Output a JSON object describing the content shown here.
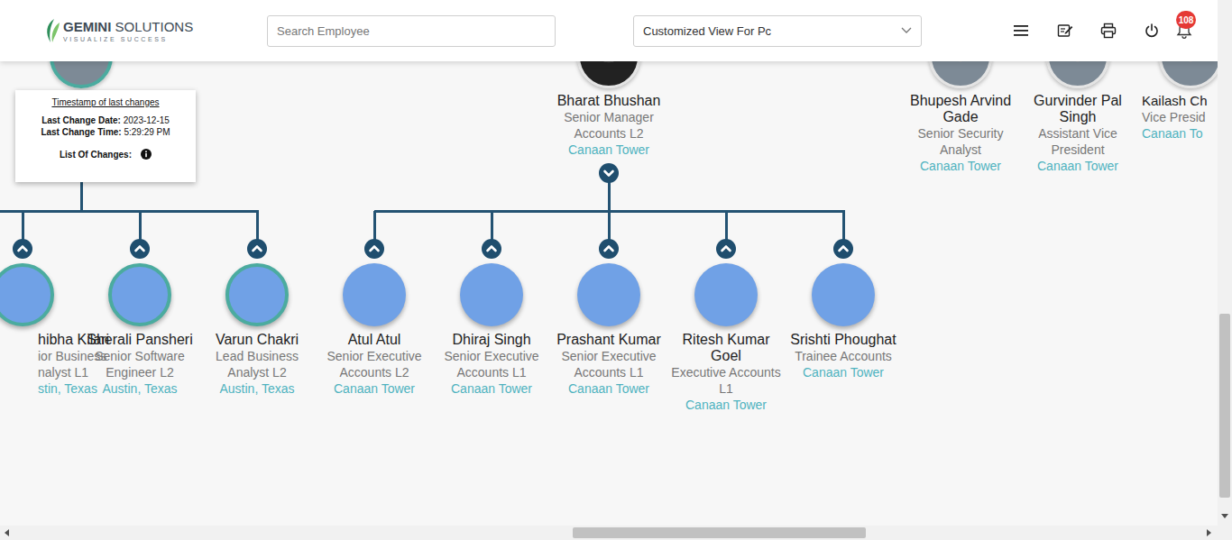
{
  "header": {
    "logo": {
      "brand": "GEMINI",
      "suffix": "SOLUTIONS",
      "tagline": "VISUALIZE SUCCESS"
    },
    "search": {
      "placeholder": "Search Employee"
    },
    "view_select": {
      "value": "Customized View For Pc"
    },
    "notifications": {
      "count": "108"
    }
  },
  "tooltip_node": {
    "ring": true,
    "tooltip": {
      "title": "Timestamp of last changes",
      "rows": [
        {
          "label": "Last Change Date:",
          "value": "2023-12-15"
        },
        {
          "label": "Last Change Time:",
          "value": "5:29:29 PM"
        }
      ],
      "changes_label": "List Of Changes:"
    }
  },
  "managers": [
    {
      "name": "Bharat Bhushan",
      "title": "Senior Manager Accounts L2",
      "location": "Canaan Tower",
      "ring": false,
      "has_reports": true,
      "expanded": true
    },
    {
      "name": "Bhupesh Arvind Gade",
      "title": "Senior Security Analyst",
      "location": "Canaan Tower",
      "ring": false,
      "has_reports": false,
      "expanded": false
    },
    {
      "name": "Gurvinder Pal Singh",
      "title": "Assistant Vice President",
      "location": "Canaan Tower",
      "ring": false,
      "has_reports": false,
      "expanded": false
    },
    {
      "name": "Kailash Ch",
      "title": "Vice Presid",
      "location": "Canaan To",
      "ring": false,
      "has_reports": false,
      "expanded": false
    }
  ],
  "teams": [
    {
      "ring": true,
      "members": [
        {
          "name": "hibha Kilari",
          "title": "ior Business nalyst L1",
          "location": "stin, Texas"
        },
        {
          "name": "Sherali Pansheri",
          "title": "Senior Software Engineer L2",
          "location": "Austin, Texas"
        },
        {
          "name": "Varun Chakri",
          "title": "Lead Business Analyst L2",
          "location": "Austin, Texas"
        }
      ]
    },
    {
      "ring": false,
      "members": [
        {
          "name": "Atul Atul",
          "title": "Senior Executive Accounts L2",
          "location": "Canaan Tower"
        },
        {
          "name": "Dhiraj Singh",
          "title": "Senior Executive Accounts L1",
          "location": "Canaan Tower"
        },
        {
          "name": "Prashant Kumar",
          "title": "Senior Executive Accounts L1",
          "location": "Canaan Tower"
        },
        {
          "name": "Ritesh Kumar Goel",
          "title": "Executive Accounts L1",
          "location": "Canaan Tower"
        },
        {
          "name": "Srishti Phoughat",
          "title": "Trainee Accounts",
          "location": "Canaan Tower"
        }
      ]
    }
  ]
}
